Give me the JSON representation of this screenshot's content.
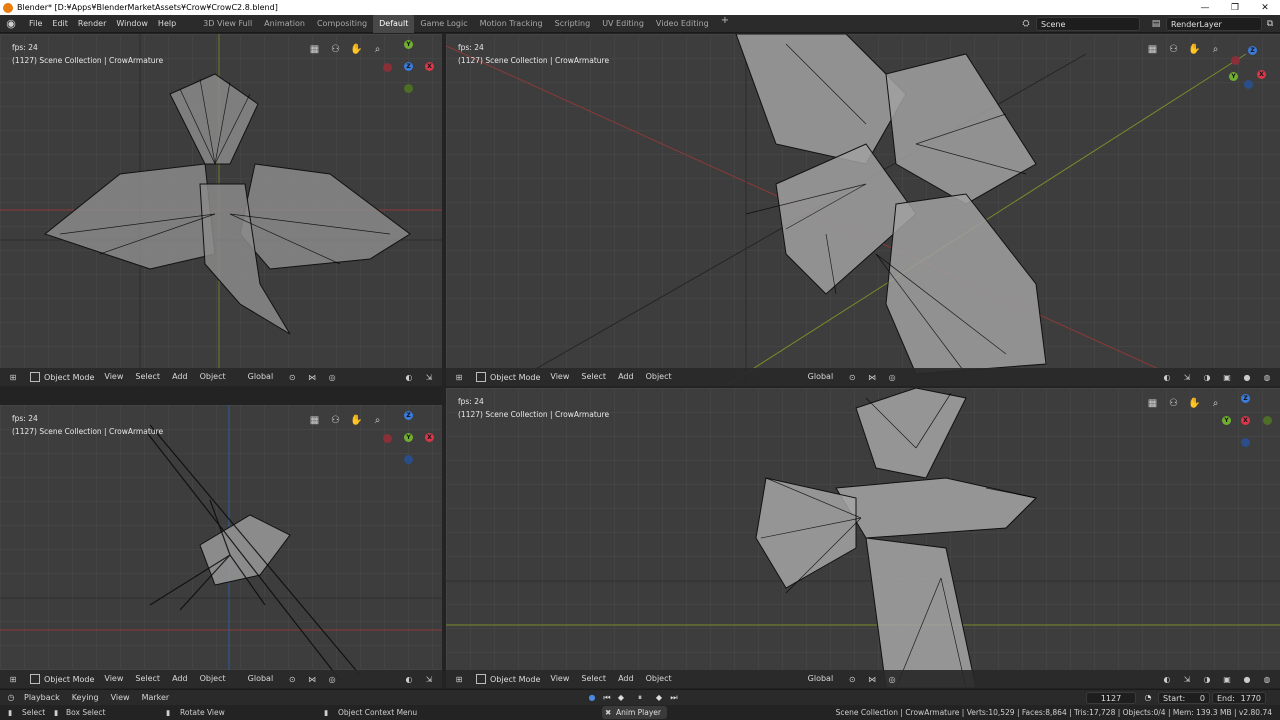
{
  "window": {
    "title": "Blender* [D:¥Apps¥BlenderMarketAssets¥Crow¥CrowC2.8.blend]"
  },
  "menu": [
    "File",
    "Edit",
    "Render",
    "Window",
    "Help"
  ],
  "workspaces": [
    "3D View Full",
    "Animation",
    "Compositing",
    "Default",
    "Game Logic",
    "Motion Tracking",
    "Scripting",
    "UV Editing",
    "Video Editing"
  ],
  "active_workspace": "Default",
  "scene": "Scene",
  "render_layer": "RenderLayer",
  "viewport": {
    "fps": "fps: 24",
    "collection": "(1127) Scene Collection | CrowArmature",
    "mode": "Object Mode",
    "view": "View",
    "select": "Select",
    "add": "Add",
    "object": "Object",
    "orientation": "Global"
  },
  "gizmo": {
    "x": "X",
    "y": "Y",
    "z": "Z"
  },
  "timeline": {
    "playback": "Playback",
    "keying": "Keying",
    "view": "View",
    "marker": "Marker",
    "current_frame": "1127",
    "start_label": "Start:",
    "start": "0",
    "end_label": "End:",
    "end": "1770"
  },
  "status": {
    "select": "Select",
    "box_select": "Box Select",
    "rotate_view": "Rotate View",
    "context_menu": "Object Context Menu",
    "anim_player": "Anim Player",
    "stats": "Scene Collection | CrowArmature | Verts:10,529 | Faces:8,864 | Tris:17,728 | Objects:0/4 | Mem: 139.3 MB | v2.80.74"
  }
}
